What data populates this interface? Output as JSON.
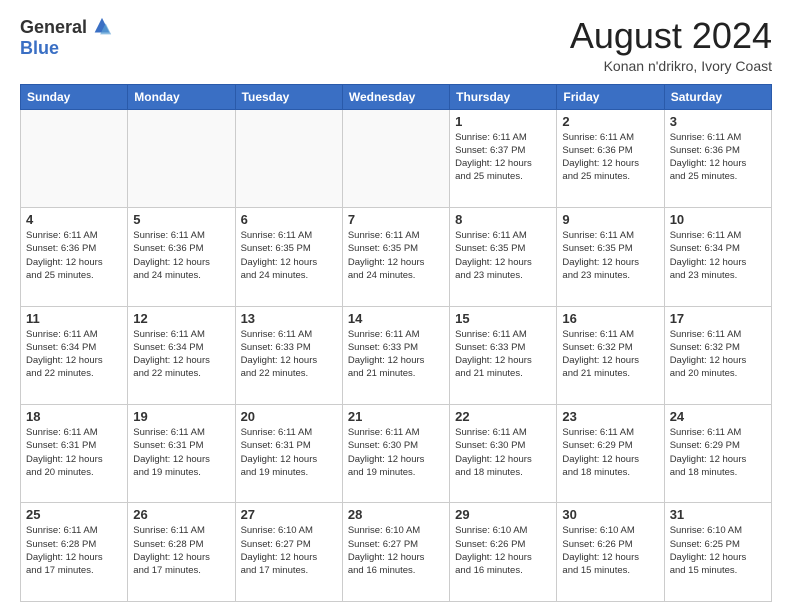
{
  "header": {
    "logo_general": "General",
    "logo_blue": "Blue",
    "month_title": "August 2024",
    "location": "Konan n'drikro, Ivory Coast"
  },
  "days_of_week": [
    "Sunday",
    "Monday",
    "Tuesday",
    "Wednesday",
    "Thursday",
    "Friday",
    "Saturday"
  ],
  "weeks": [
    [
      {
        "day": "",
        "info": ""
      },
      {
        "day": "",
        "info": ""
      },
      {
        "day": "",
        "info": ""
      },
      {
        "day": "",
        "info": ""
      },
      {
        "day": "1",
        "info": "Sunrise: 6:11 AM\nSunset: 6:37 PM\nDaylight: 12 hours\nand 25 minutes."
      },
      {
        "day": "2",
        "info": "Sunrise: 6:11 AM\nSunset: 6:36 PM\nDaylight: 12 hours\nand 25 minutes."
      },
      {
        "day": "3",
        "info": "Sunrise: 6:11 AM\nSunset: 6:36 PM\nDaylight: 12 hours\nand 25 minutes."
      }
    ],
    [
      {
        "day": "4",
        "info": "Sunrise: 6:11 AM\nSunset: 6:36 PM\nDaylight: 12 hours\nand 25 minutes."
      },
      {
        "day": "5",
        "info": "Sunrise: 6:11 AM\nSunset: 6:36 PM\nDaylight: 12 hours\nand 24 minutes."
      },
      {
        "day": "6",
        "info": "Sunrise: 6:11 AM\nSunset: 6:35 PM\nDaylight: 12 hours\nand 24 minutes."
      },
      {
        "day": "7",
        "info": "Sunrise: 6:11 AM\nSunset: 6:35 PM\nDaylight: 12 hours\nand 24 minutes."
      },
      {
        "day": "8",
        "info": "Sunrise: 6:11 AM\nSunset: 6:35 PM\nDaylight: 12 hours\nand 23 minutes."
      },
      {
        "day": "9",
        "info": "Sunrise: 6:11 AM\nSunset: 6:35 PM\nDaylight: 12 hours\nand 23 minutes."
      },
      {
        "day": "10",
        "info": "Sunrise: 6:11 AM\nSunset: 6:34 PM\nDaylight: 12 hours\nand 23 minutes."
      }
    ],
    [
      {
        "day": "11",
        "info": "Sunrise: 6:11 AM\nSunset: 6:34 PM\nDaylight: 12 hours\nand 22 minutes."
      },
      {
        "day": "12",
        "info": "Sunrise: 6:11 AM\nSunset: 6:34 PM\nDaylight: 12 hours\nand 22 minutes."
      },
      {
        "day": "13",
        "info": "Sunrise: 6:11 AM\nSunset: 6:33 PM\nDaylight: 12 hours\nand 22 minutes."
      },
      {
        "day": "14",
        "info": "Sunrise: 6:11 AM\nSunset: 6:33 PM\nDaylight: 12 hours\nand 21 minutes."
      },
      {
        "day": "15",
        "info": "Sunrise: 6:11 AM\nSunset: 6:33 PM\nDaylight: 12 hours\nand 21 minutes."
      },
      {
        "day": "16",
        "info": "Sunrise: 6:11 AM\nSunset: 6:32 PM\nDaylight: 12 hours\nand 21 minutes."
      },
      {
        "day": "17",
        "info": "Sunrise: 6:11 AM\nSunset: 6:32 PM\nDaylight: 12 hours\nand 20 minutes."
      }
    ],
    [
      {
        "day": "18",
        "info": "Sunrise: 6:11 AM\nSunset: 6:31 PM\nDaylight: 12 hours\nand 20 minutes."
      },
      {
        "day": "19",
        "info": "Sunrise: 6:11 AM\nSunset: 6:31 PM\nDaylight: 12 hours\nand 19 minutes."
      },
      {
        "day": "20",
        "info": "Sunrise: 6:11 AM\nSunset: 6:31 PM\nDaylight: 12 hours\nand 19 minutes."
      },
      {
        "day": "21",
        "info": "Sunrise: 6:11 AM\nSunset: 6:30 PM\nDaylight: 12 hours\nand 19 minutes."
      },
      {
        "day": "22",
        "info": "Sunrise: 6:11 AM\nSunset: 6:30 PM\nDaylight: 12 hours\nand 18 minutes."
      },
      {
        "day": "23",
        "info": "Sunrise: 6:11 AM\nSunset: 6:29 PM\nDaylight: 12 hours\nand 18 minutes."
      },
      {
        "day": "24",
        "info": "Sunrise: 6:11 AM\nSunset: 6:29 PM\nDaylight: 12 hours\nand 18 minutes."
      }
    ],
    [
      {
        "day": "25",
        "info": "Sunrise: 6:11 AM\nSunset: 6:28 PM\nDaylight: 12 hours\nand 17 minutes."
      },
      {
        "day": "26",
        "info": "Sunrise: 6:11 AM\nSunset: 6:28 PM\nDaylight: 12 hours\nand 17 minutes."
      },
      {
        "day": "27",
        "info": "Sunrise: 6:10 AM\nSunset: 6:27 PM\nDaylight: 12 hours\nand 17 minutes."
      },
      {
        "day": "28",
        "info": "Sunrise: 6:10 AM\nSunset: 6:27 PM\nDaylight: 12 hours\nand 16 minutes."
      },
      {
        "day": "29",
        "info": "Sunrise: 6:10 AM\nSunset: 6:26 PM\nDaylight: 12 hours\nand 16 minutes."
      },
      {
        "day": "30",
        "info": "Sunrise: 6:10 AM\nSunset: 6:26 PM\nDaylight: 12 hours\nand 15 minutes."
      },
      {
        "day": "31",
        "info": "Sunrise: 6:10 AM\nSunset: 6:25 PM\nDaylight: 12 hours\nand 15 minutes."
      }
    ]
  ]
}
